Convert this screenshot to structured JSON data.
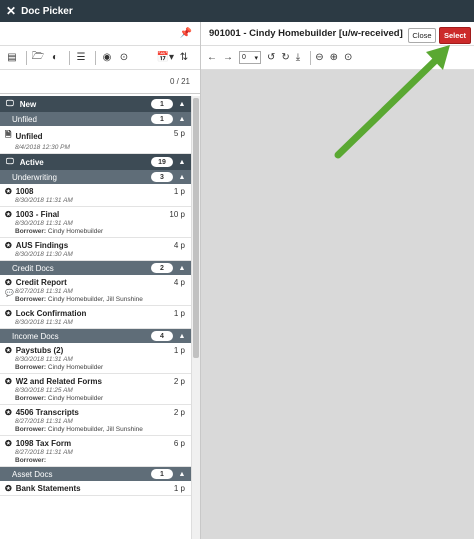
{
  "app": {
    "title": "Doc Picker"
  },
  "left_panel": {
    "count": "0 / 21",
    "sections": [
      {
        "label": "New",
        "count": "1",
        "groups": [
          {
            "label": "Unfiled",
            "count": "1",
            "docs": [
              {
                "name": "Unfiled",
                "pages": "5 p",
                "date": "8/4/2018 12:30 PM",
                "borrower": null
              }
            ]
          }
        ]
      },
      {
        "label": "Active",
        "count": "19",
        "groups": [
          {
            "label": "Underwriting",
            "count": "3",
            "docs": [
              {
                "name": "1008",
                "pages": "1 p",
                "date": "8/30/2018 11:31 AM",
                "borrower": null
              },
              {
                "name": "1003 - Final",
                "pages": "10 p",
                "date": "8/30/2018 11:31 AM",
                "borrower": "Cindy Homebuilder"
              },
              {
                "name": "AUS Findings",
                "pages": "4 p",
                "date": "8/30/2018 11:30 AM",
                "borrower": null
              }
            ]
          },
          {
            "label": "Credit Docs",
            "count": "2",
            "docs": [
              {
                "name": "Credit Report",
                "pages": "4 p",
                "date": "8/27/2018 11:31 AM",
                "borrower": "Cindy Homebuilder, Jill Sunshine",
                "comment": true
              },
              {
                "name": "Lock Confirmation",
                "pages": "1 p",
                "date": "8/30/2018 11:31 AM",
                "borrower": null
              }
            ]
          },
          {
            "label": "Income Docs",
            "count": "4",
            "docs": [
              {
                "name": "Paystubs (2)",
                "pages": "1 p",
                "date": "8/30/2018 11:31 AM",
                "borrower": "Cindy Homebuilder"
              },
              {
                "name": "W2 and Related Forms",
                "pages": "2 p",
                "date": "8/30/2018 11:25 AM",
                "borrower": "Cindy Homebuilder"
              },
              {
                "name": "4506 Transcripts",
                "pages": "2 p",
                "date": "8/27/2018 11:31 AM",
                "borrower": "Cindy Homebuilder, Jill Sunshine"
              },
              {
                "name": "1098 Tax Form",
                "pages": "6 p",
                "date": "8/27/2018 11:31 AM",
                "borrower": ""
              }
            ]
          },
          {
            "label": "Asset Docs",
            "count": "1",
            "docs": [
              {
                "name": "Bank Statements",
                "pages": "1 p",
                "date": "",
                "borrower": null
              }
            ]
          }
        ]
      }
    ],
    "borrower_label": "Borrower:"
  },
  "viewer": {
    "doc_title": "901001 - Cindy Homebuilder [u/w-received]",
    "close_label": "Close",
    "select_label": "Select",
    "page_value": "0"
  },
  "colors": {
    "titlebar": "#2c3a44",
    "section": "#3d4b55",
    "subsection": "#5f6d78",
    "select": "#cc2a2a",
    "arrow": "#5aa832"
  }
}
